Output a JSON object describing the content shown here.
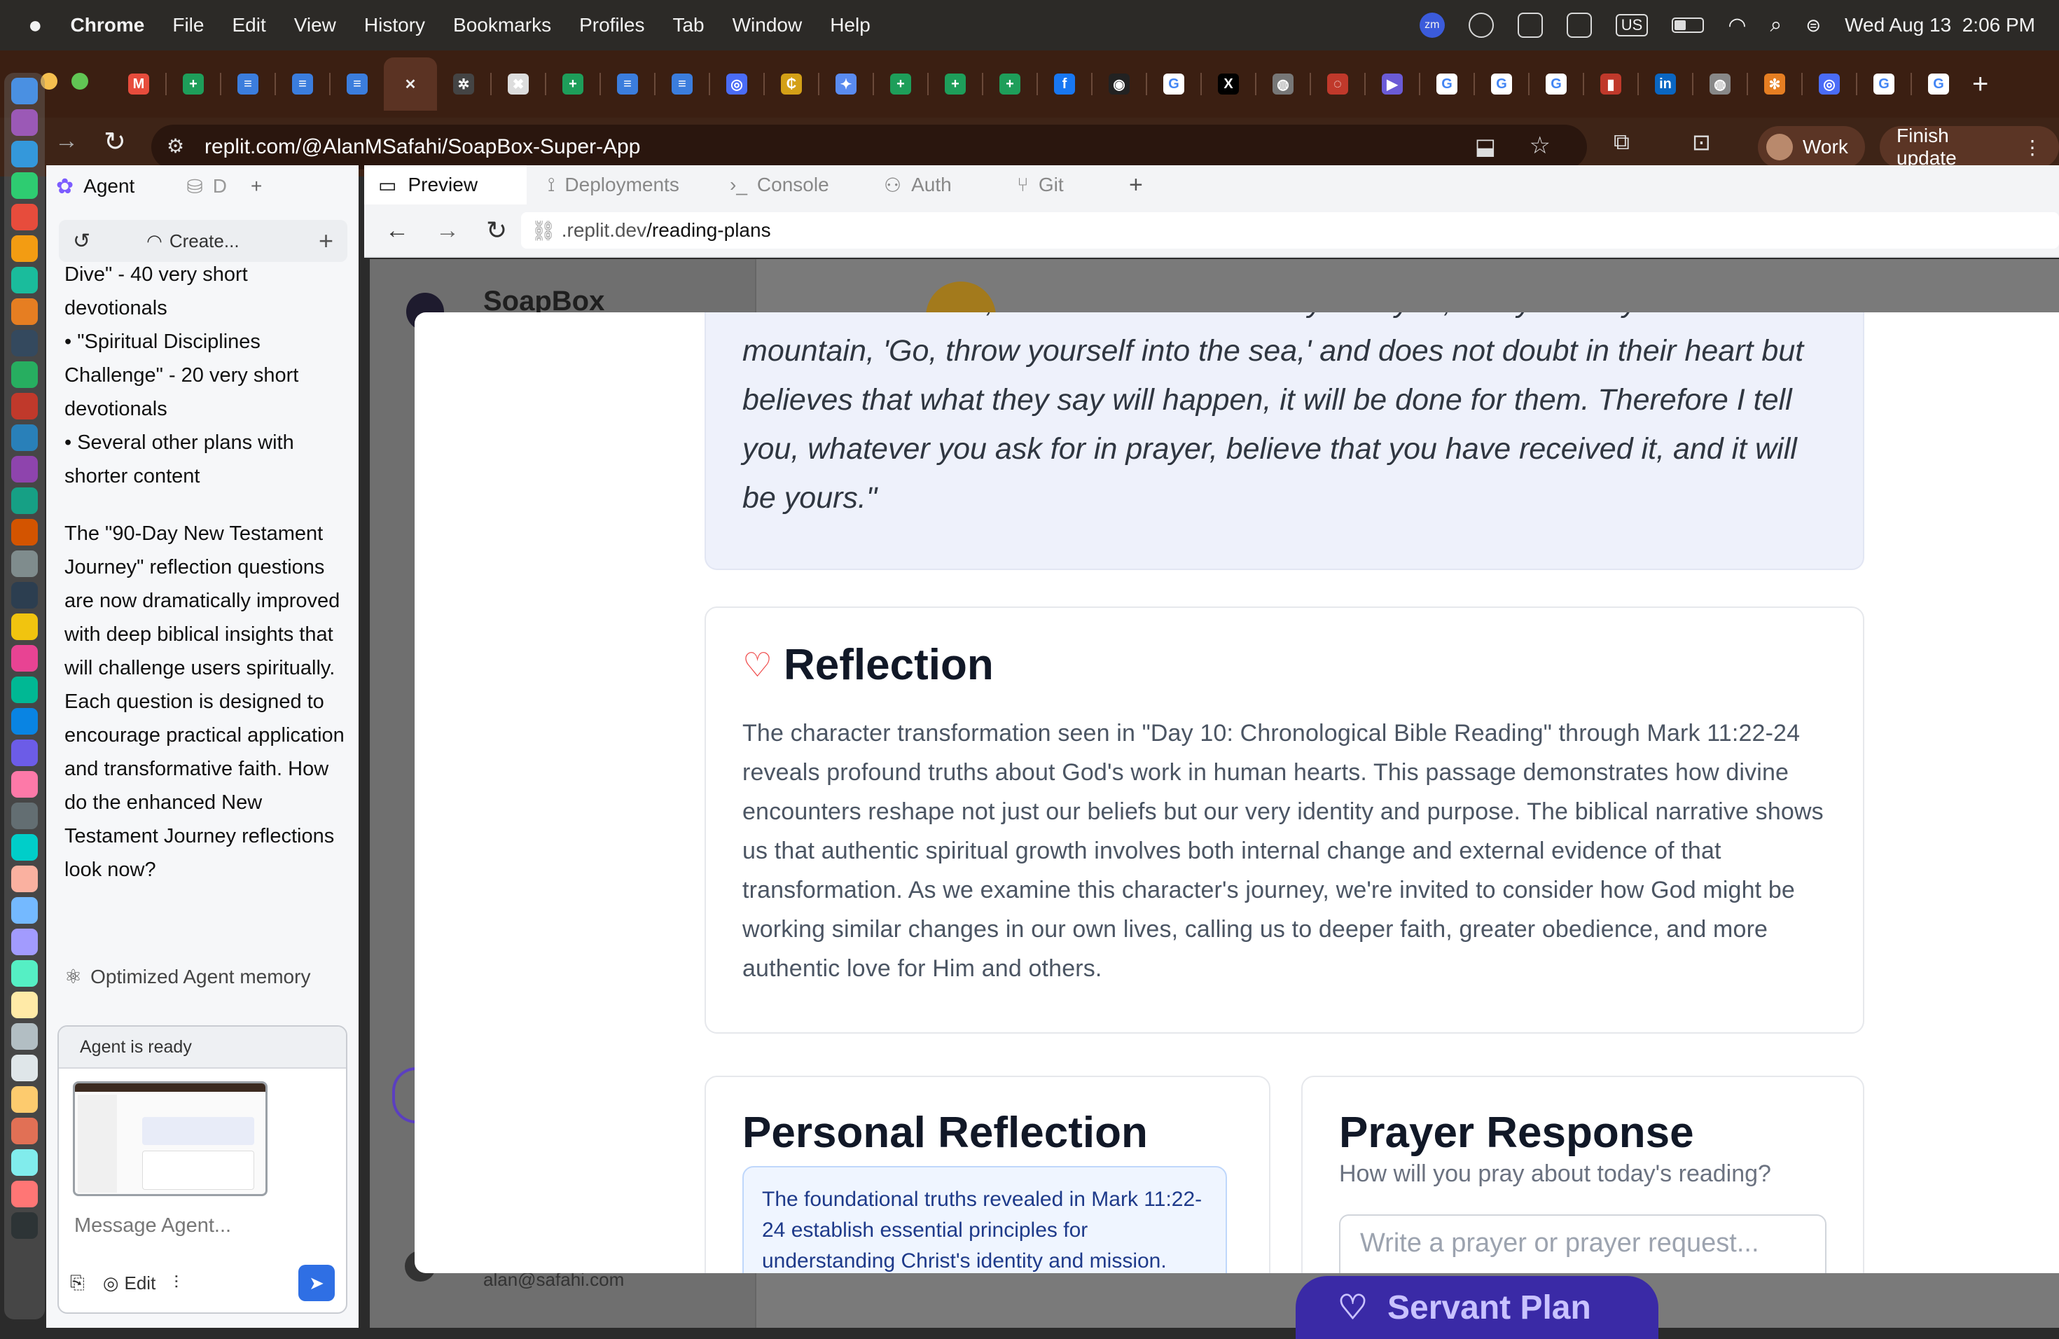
{
  "menubar": {
    "app_name": "Chrome",
    "menus": [
      "File",
      "Edit",
      "View",
      "History",
      "Bookmarks",
      "Profiles",
      "Tab",
      "Window",
      "Help"
    ],
    "status": {
      "keyboard": "US",
      "datetime": "Wed Aug 13  2:06 PM",
      "zoom_label": "zm"
    }
  },
  "tabs": [
    {
      "icon": "gmail-icon",
      "color": "#e74c3c",
      "glyph": "M"
    },
    {
      "icon": "sheets-icon",
      "color": "#1e9e5a",
      "glyph": "+"
    },
    {
      "icon": "docs-icon",
      "color": "#3b7ddd",
      "glyph": "≡"
    },
    {
      "icon": "docs-icon",
      "color": "#3b7ddd",
      "glyph": "≡"
    },
    {
      "icon": "docs-icon",
      "color": "#3b7ddd",
      "glyph": "≡"
    },
    {
      "icon": "close-icon",
      "color": "#5b3323",
      "glyph": "✕",
      "active": true
    },
    {
      "icon": "openai-icon",
      "color": "#444",
      "glyph": "✲"
    },
    {
      "icon": "x-circle-icon",
      "color": "#ddd",
      "glyph": "✖"
    },
    {
      "icon": "sheets-icon",
      "color": "#1e9e5a",
      "glyph": "+"
    },
    {
      "icon": "docs-icon",
      "color": "#3b7ddd",
      "glyph": "≡"
    },
    {
      "icon": "docs-icon",
      "color": "#3b7ddd",
      "glyph": "≡"
    },
    {
      "icon": "target-icon",
      "color": "#4a6cf7",
      "glyph": "◎"
    },
    {
      "icon": "coin-icon",
      "color": "#d4a017",
      "glyph": "₵"
    },
    {
      "icon": "gemini-icon",
      "color": "#5a8bf0",
      "glyph": "✦"
    },
    {
      "icon": "sheets-icon",
      "color": "#1e9e5a",
      "glyph": "+"
    },
    {
      "icon": "sheets-icon",
      "color": "#1e9e5a",
      "glyph": "+"
    },
    {
      "icon": "sheets-icon",
      "color": "#1e9e5a",
      "glyph": "+"
    },
    {
      "icon": "facebook-icon",
      "color": "#1877f2",
      "glyph": "f"
    },
    {
      "icon": "github-icon",
      "color": "#222",
      "glyph": "◉"
    },
    {
      "icon": "google-icon",
      "color": "#ffffff",
      "glyph": "G"
    },
    {
      "icon": "x-icon",
      "color": "#000",
      "glyph": "X"
    },
    {
      "icon": "globe-icon",
      "color": "#777",
      "glyph": "◍"
    },
    {
      "icon": "loading-icon",
      "color": "#c0392b",
      "glyph": "◌"
    },
    {
      "icon": "replit-icon",
      "color": "#6b5bd6",
      "glyph": "▶"
    },
    {
      "icon": "google-icon",
      "color": "#ffffff",
      "glyph": "G"
    },
    {
      "icon": "google-icon",
      "color": "#ffffff",
      "glyph": "G"
    },
    {
      "icon": "google-icon",
      "color": "#ffffff",
      "glyph": "G"
    },
    {
      "icon": "bookmark-icon",
      "color": "#c0392b",
      "glyph": "▮"
    },
    {
      "icon": "linkedin-icon",
      "color": "#0a66c2",
      "glyph": "in"
    },
    {
      "icon": "globe-icon",
      "color": "#888",
      "glyph": "◍"
    },
    {
      "icon": "asterisk-icon",
      "color": "#e67e22",
      "glyph": "✻"
    },
    {
      "icon": "target-icon",
      "color": "#4a6cf7",
      "glyph": "◎"
    },
    {
      "icon": "google-icon",
      "color": "#ffffff",
      "glyph": "G"
    },
    {
      "icon": "google-icon",
      "color": "#ffffff",
      "glyph": "G"
    }
  ],
  "toolbar": {
    "url": "replit.com/@AlanMSafahi/SoapBox-Super-App",
    "profile_label": "Work",
    "update_label": "Finish update"
  },
  "replit": {
    "left_tabs": {
      "agent": "Agent",
      "db": "D"
    },
    "history_label": "Create...",
    "chat": {
      "p1": "Dive\" - 40 very short devotionals",
      "p2": "• \"Spiritual Disciplines Challenge\" - 20 very short devotionals",
      "p3": "• Several other plans with shorter content",
      "p4": "The \"90-Day New Testament Journey\" reflection questions are now dramatically improved with deep biblical insights that will challenge users spiritually. Each question is designed to encourage practical application and transformative faith. How do the enhanced New Testament Journey reflections look now?"
    },
    "memory_label": "Optimized Agent memory",
    "agent_ready": "Agent is ready",
    "message_placeholder": "Message Agent...",
    "edit_label": "Edit",
    "workspace_tabs": [
      "Preview",
      "Deployments",
      "Console",
      "Auth",
      "Git"
    ],
    "preview_url_prefix": ".replit.dev",
    "preview_url_path": "/reading-plans"
  },
  "app": {
    "brand": "SoapBox",
    "user_email": "alan@safahi.com",
    "bottom_button": "Servant Plan"
  },
  "modal": {
    "scripture_partial": "\"Have faith in God,\" Jesus answered. \"Truly I tell you, if anyone says to this",
    "scripture_rest": "mountain, 'Go, throw yourself into the sea,' and does not doubt in their heart but believes that what they say will happen, it will be done for them. Therefore I tell you, whatever you ask for in prayer, believe that you have received it, and it will be yours.\"",
    "reflection_title": "Reflection",
    "reflection_body": "The character transformation seen in \"Day 10: Chronological Bible Reading\" through Mark 11:22-24 reveals profound truths about God's work in human hearts. This passage demonstrates how divine encounters reshape not just our beliefs but our very identity and purpose. The biblical narrative shows us that authentic spiritual growth involves both internal change and external evidence of that transformation. As we examine this character's journey, we're invited to consider how God might be working similar changes in our own lives, calling us to deeper faith, greater obedience, and more authentic love for Him and others.",
    "personal_title": "Personal Reflection",
    "personal_prompt": "The foundational truths revealed in Mark 11:22-24 establish essential principles for understanding Christ's identity and mission.",
    "prayer_title": "Prayer Response",
    "prayer_subtitle": "How will you pray about today's reading?",
    "prayer_placeholder": "Write a prayer or prayer request..."
  },
  "colors": {
    "accent": "#ef4444",
    "brand_purple": "#4c1d95",
    "link_blue": "#1e3a8a"
  }
}
